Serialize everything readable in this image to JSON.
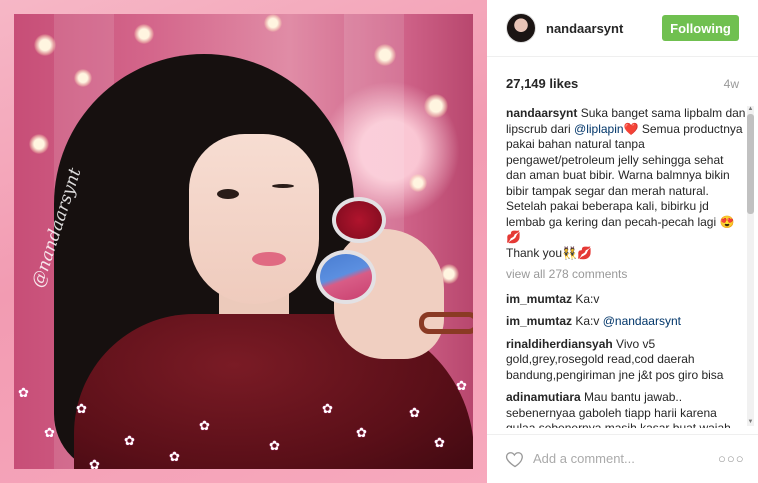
{
  "post": {
    "username": "nandaarsynt",
    "follow_label": "Following",
    "likes": "27,149 likes",
    "time": "4w",
    "watermark": "@nandaarsynt"
  },
  "caption": {
    "username": "nandaarsynt",
    "text_1": " Suka banget sama lipbalm dan lipscrub dari ",
    "mention": "@liplapin",
    "emoji_1": "❤️",
    "text_2": " Semua productnya pakai bahan natural tanpa pengawet/petroleum jelly sehingga sehat dan aman buat bibir. Warna balmnya bikin bibir tampak segar dan merah natural. Setelah pakai beberapa kali, bibirku jd lembab ga kering dan pecah-pecah lagi ",
    "emoji_2": "😍💋",
    "text_3": "Thank you",
    "emoji_3": "👯💋"
  },
  "view_all": "view all 278 comments",
  "comments": [
    {
      "user": "im_mumtaz",
      "text": " Ka:v",
      "mention": ""
    },
    {
      "user": "im_mumtaz",
      "text": " Ka:v ",
      "mention": "@nandaarsynt"
    },
    {
      "user": "rinaldiherdiansyah",
      "text": " Vivo v5 gold,grey,rosegold read,cod daerah bandung,pengiriman jne j&t pos giro bisa",
      "mention": ""
    },
    {
      "user": "adinamutiara",
      "text": " Mau bantu jawab.. sebenernyaa gaboleh tiapp harii karena gulaa sebenernya masih kasar buat wajah apalagi ditambah lemon lamalama",
      "mention": ""
    }
  ],
  "footer": {
    "placeholder": "Add a comment...",
    "more": "○○○"
  },
  "icons": {
    "heart": "heart-icon",
    "more": "more-options-icon",
    "scroll_up": "▲",
    "scroll_down": "▼"
  },
  "colors": {
    "follow_button": "#70c050",
    "mention": "#003569"
  }
}
